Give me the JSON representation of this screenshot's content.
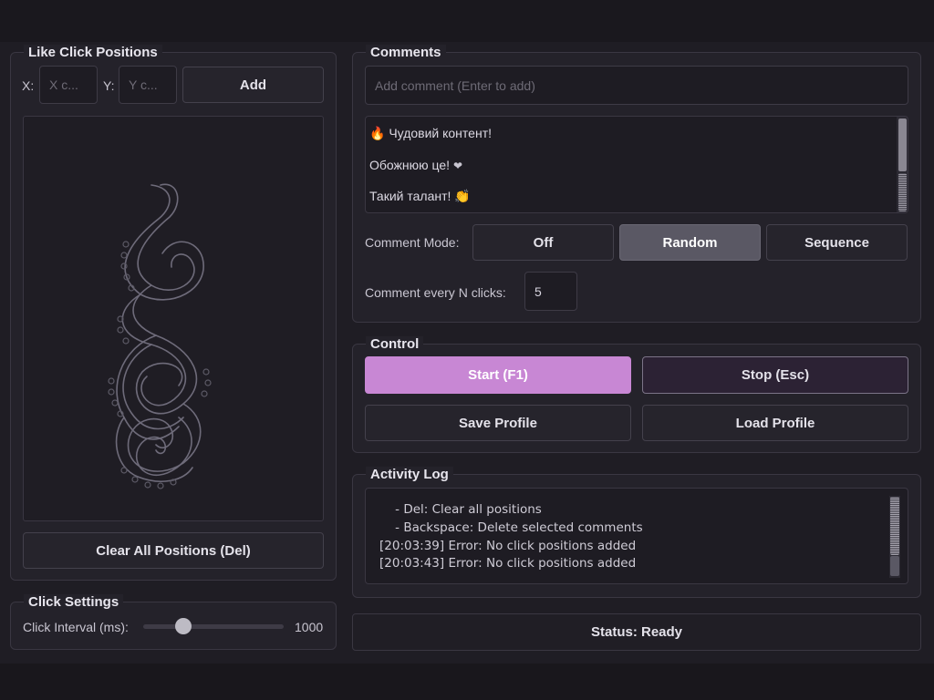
{
  "positions": {
    "title": "Like Click Positions",
    "x_label": "X:",
    "y_label": "Y:",
    "x_placeholder": "X c...",
    "y_placeholder": "Y c...",
    "add_label": "Add",
    "clear_label": "Clear All Positions (Del)",
    "canvas_icon": "octopus-tentacle-icon"
  },
  "click_settings": {
    "title": "Click Settings",
    "interval_label": "Click Interval (ms):",
    "interval_value": "1000",
    "slider_fraction": 0.29
  },
  "comments": {
    "title": "Comments",
    "placeholder": "Add comment (Enter to add)",
    "items": [
      {
        "emoji": "🔥",
        "text": "Чудовий контент!"
      },
      {
        "text": "Обожнюю це! ",
        "emoji": "❤"
      },
      {
        "text": "Такий талант! ",
        "emoji": "👏"
      }
    ],
    "mode_label": "Comment Mode:",
    "modes": [
      "Off",
      "Random",
      "Sequence"
    ],
    "selected_mode": "Random",
    "every_label": "Comment every N clicks:",
    "every_value": "5"
  },
  "control": {
    "title": "Control",
    "start_label": "Start (F1)",
    "stop_label": "Stop (Esc)",
    "save_label": "Save Profile",
    "load_label": "Load Profile"
  },
  "log": {
    "title": "Activity Log",
    "lines": [
      "    - Del: Clear all positions",
      "    - Backspace: Delete selected comments",
      "[20:03:39] Error: No click positions added",
      "[20:03:43] Error: No click positions added"
    ]
  },
  "status": {
    "label": "Status: Ready"
  },
  "colors": {
    "accent": "#c887d4",
    "background": "#1f1d24",
    "panel": "#24222a",
    "selected": "#5a5864"
  }
}
